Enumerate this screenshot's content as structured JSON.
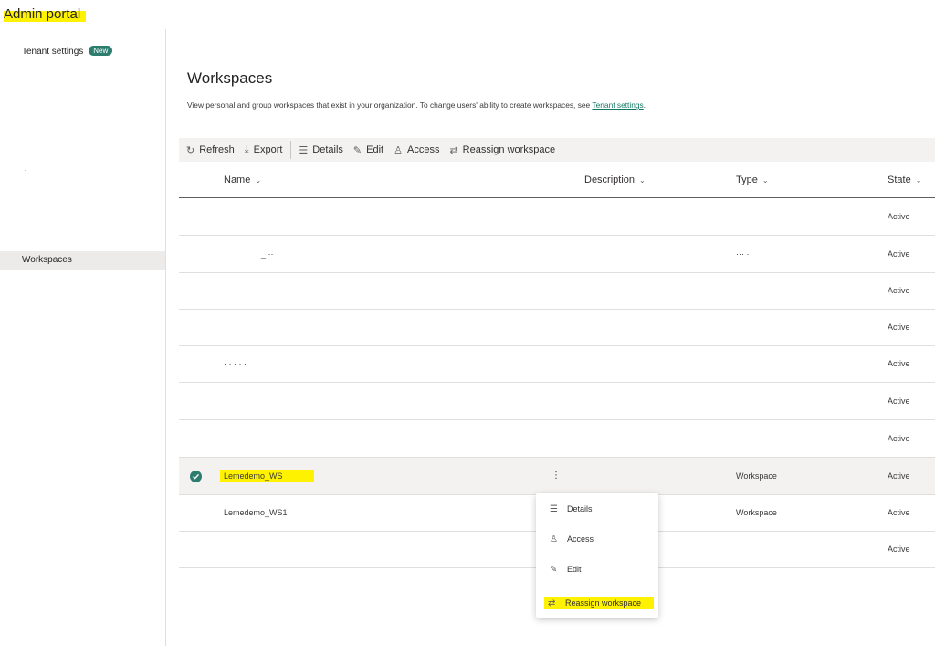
{
  "app": {
    "title": "Admin portal"
  },
  "sidebar": {
    "items": [
      {
        "label": "Tenant settings",
        "badge": "New"
      },
      {
        "label": "·"
      },
      {
        "label": "Workspaces"
      }
    ]
  },
  "page": {
    "title": "Workspaces",
    "description": "View personal and group workspaces that exist in your organization. To change users' ability to create workspaces, see ",
    "description_link": "Tenant settings",
    "description_end": "."
  },
  "toolbar": {
    "refresh": "Refresh",
    "export": "Export",
    "details": "Details",
    "edit": "Edit",
    "access": "Access",
    "reassign": "Reassign workspace"
  },
  "table": {
    "columns": {
      "name": "Name",
      "description": "Description",
      "type": "Type",
      "state": "State"
    },
    "rows": [
      {
        "name": "",
        "type": "",
        "state": "Active"
      },
      {
        "name": "_ ··",
        "type": "··· ·",
        "state": "Active"
      },
      {
        "name": "",
        "type": "",
        "state": "Active"
      },
      {
        "name": "",
        "type": "",
        "state": "Active"
      },
      {
        "name": "· · ·   · ·",
        "type": "",
        "state": "Active"
      },
      {
        "name": "",
        "type": "",
        "state": "Active"
      },
      {
        "name": "",
        "type": "",
        "state": "Active"
      },
      {
        "name": "Lemedemo_WS",
        "type": "Workspace",
        "state": "Active"
      },
      {
        "name": "Lemedemo_WS1",
        "type": "Workspace",
        "state": "Active"
      },
      {
        "name": "",
        "type": "",
        "state": "Active"
      }
    ],
    "more_icon": "⋮"
  },
  "context_menu": {
    "items": [
      {
        "label": "Details",
        "icon": "list-icon"
      },
      {
        "label": "Access",
        "icon": "person-icon"
      },
      {
        "label": "Edit",
        "icon": "pencil-icon"
      },
      {
        "label": "Reassign workspace",
        "icon": "reassign-icon"
      }
    ]
  },
  "colors": {
    "accent": "#117865",
    "badge": "#2d7d6e",
    "highlight": "#fff200",
    "toolbar_bg": "#f3f2f1"
  }
}
